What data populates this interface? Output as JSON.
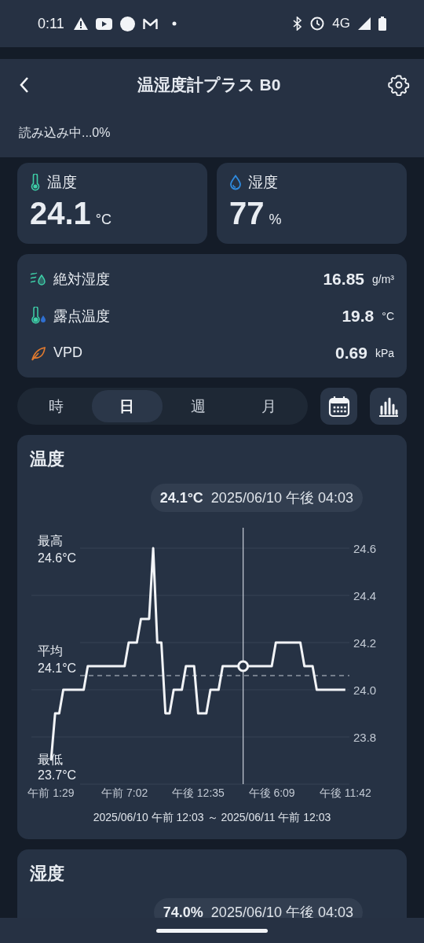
{
  "status_bar": {
    "time": "0:11",
    "network": "4G"
  },
  "header": {
    "title": "温湿度計プラス B0",
    "loading": "読み込み中...0%"
  },
  "readings": [
    {
      "kind": "temperature",
      "label": "温度",
      "value": "24.1",
      "unit": "°C"
    },
    {
      "kind": "humidity",
      "label": "湿度",
      "value": "77",
      "unit": "%"
    }
  ],
  "details": [
    {
      "kind": "absolute-humidity",
      "label": "絶対湿度",
      "value": "16.85",
      "unit": "g/m³"
    },
    {
      "kind": "dew-point",
      "label": "露点温度",
      "value": "19.8",
      "unit": "°C"
    },
    {
      "kind": "vpd",
      "label": "VPD",
      "value": "0.69",
      "unit": "kPa"
    }
  ],
  "period_tabs": [
    {
      "label": "時",
      "selected": false
    },
    {
      "label": "日",
      "selected": true
    },
    {
      "label": "週",
      "selected": false
    },
    {
      "label": "月",
      "selected": false
    }
  ],
  "charts": [
    {
      "title": "温度",
      "tooltip": {
        "value": "24.1°C",
        "time": "2025/06/10 午後 04:03"
      },
      "cursor": {
        "level": 0.671
      },
      "stats": [
        {
          "kind": "max",
          "label": "最高",
          "value": "24.6°C"
        },
        {
          "kind": "avg",
          "label": "平均",
          "value": "24.1°C"
        },
        {
          "kind": "min",
          "label": "最低",
          "value": "23.7°C"
        }
      ],
      "range": "2025/06/10 午前 12:03 ～ 2025/06/11 午前 12:03",
      "chart_data": {
        "type": "line",
        "ylim": [
          23.6,
          24.6
        ],
        "grid": true,
        "categories": [
          null,
          null,
          null,
          null,
          "午前 1:29",
          null,
          null,
          null,
          null,
          null,
          null,
          null,
          null,
          null,
          null,
          null,
          null,
          null,
          null,
          null,
          null,
          null,
          "午前 7:02",
          null,
          null,
          null,
          null,
          null,
          null,
          null,
          null,
          null,
          null,
          null,
          null,
          null,
          null,
          null,
          null,
          null,
          "午後 12:35",
          null,
          null,
          null,
          null,
          null,
          null,
          null,
          null,
          null,
          null,
          null,
          null,
          null,
          null,
          null,
          null,
          null,
          "午後 6:09",
          null,
          null,
          null,
          null,
          null,
          null,
          null,
          null,
          null,
          null,
          null,
          null,
          null,
          null,
          null,
          null,
          null,
          "午後 11:42"
        ],
        "series": [
          {
            "color": "#f2f4f7",
            "values": [
              null,
              null,
              null,
              null,
              23.7,
              23.9,
              23.9,
              24.0,
              24.0,
              24.0,
              24.0,
              24.0,
              24.0,
              24.1,
              24.1,
              24.1,
              24.1,
              24.1,
              24.1,
              24.1,
              24.1,
              24.1,
              24.1,
              24.2,
              24.2,
              24.2,
              24.3,
              24.3,
              24.3,
              24.6,
              24.2,
              24.2,
              23.9,
              23.9,
              24.0,
              24.0,
              24.0,
              24.1,
              24.1,
              24.1,
              23.9,
              23.9,
              23.9,
              24.0,
              24.0,
              24.0,
              24.1,
              24.1,
              24.1,
              24.1,
              24.1,
              24.1,
              24.1,
              24.1,
              24.1,
              24.1,
              24.1,
              24.1,
              24.1,
              24.2,
              24.2,
              24.2,
              24.2,
              24.2,
              24.2,
              24.2,
              24.1,
              24.1,
              24.1,
              24.0,
              24.0,
              24.0,
              24.0,
              24.0,
              24.0,
              24.0,
              24.0
            ]
          }
        ],
        "yticks": [
          {
            "value": 23.8,
            "label": "23.8"
          },
          {
            "value": 24.0,
            "label": "24.0"
          },
          {
            "value": 24.2,
            "label": "24.2"
          },
          {
            "value": 24.4,
            "label": "24.4"
          },
          {
            "value": 24.6,
            "label": "24.6"
          }
        ],
        "ref_lines": [
          {
            "axis": "y",
            "value": 24.06
          }
        ]
      }
    },
    {
      "title": "湿度",
      "tooltip": {
        "value": "74.0%",
        "time": "2025/06/10 午後 04:03"
      }
    }
  ]
}
